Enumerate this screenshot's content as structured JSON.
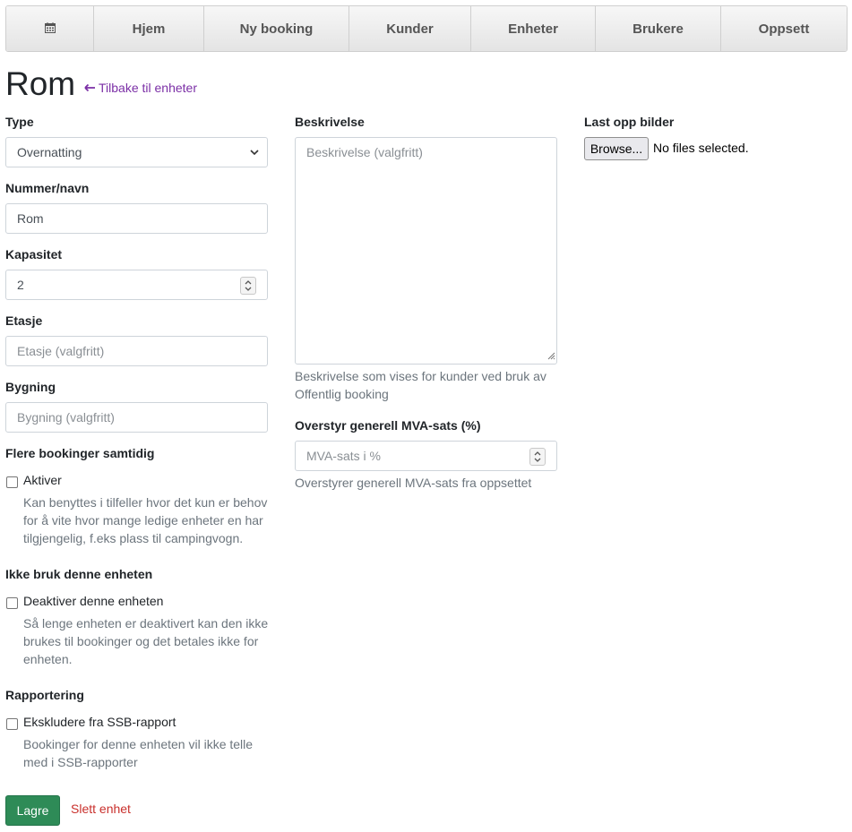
{
  "nav": {
    "calendar_icon": "calendar-icon",
    "items": [
      "Hjem",
      "Ny booking",
      "Kunder",
      "Enheter",
      "Brukere",
      "Oppsett"
    ]
  },
  "page": {
    "title": "Rom",
    "back_link": "Tilbake til enheter",
    "back_icon": "arrow-left-icon"
  },
  "form": {
    "type": {
      "label": "Type",
      "value": "Overnatting"
    },
    "number": {
      "label": "Nummer/navn",
      "value": "Rom"
    },
    "capacity": {
      "label": "Kapasitet",
      "value": "2"
    },
    "floor": {
      "label": "Etasje",
      "placeholder": "Etasje (valgfritt)"
    },
    "building": {
      "label": "Bygning",
      "placeholder": "Bygning (valgfritt)"
    },
    "multiple": {
      "label": "Flere bookinger samtidig",
      "checkbox_label": "Aktiver",
      "help": "Kan benyttes i tilfeller hvor det kun er behov for å vite hvor mange ledige enheter en har tilgjengelig, f.eks plass til campingvogn."
    },
    "disable": {
      "label": "Ikke bruk denne enheten",
      "checkbox_label": "Deaktiver denne enheten",
      "help": "Så lenge enheten er deaktivert kan den ikke brukes til bookinger og det betales ikke for enheten."
    },
    "reporting": {
      "label": "Rapportering",
      "checkbox_label": "Ekskludere fra SSB-rapport",
      "help": "Bookinger for denne enheten vil ikke telle med i SSB-rapporter"
    },
    "description": {
      "label": "Beskrivelse",
      "placeholder": "Beskrivelse (valgfritt)",
      "help": "Beskrivelse som vises for kunder ved bruk av Offentlig booking"
    },
    "vat": {
      "label": "Overstyr generell MVA-sats (%)",
      "placeholder": "MVA-sats i %",
      "help": "Overstyrer generell MVA-sats fra oppsettet"
    },
    "upload": {
      "label": "Last opp bilder",
      "button": "Browse...",
      "status": "No files selected."
    },
    "save": "Lagre",
    "delete": "Slett enhet"
  },
  "colors": {
    "save_button": "#2e8b57",
    "back_link": "#7b2fa6",
    "delete_link": "#c9302c"
  }
}
